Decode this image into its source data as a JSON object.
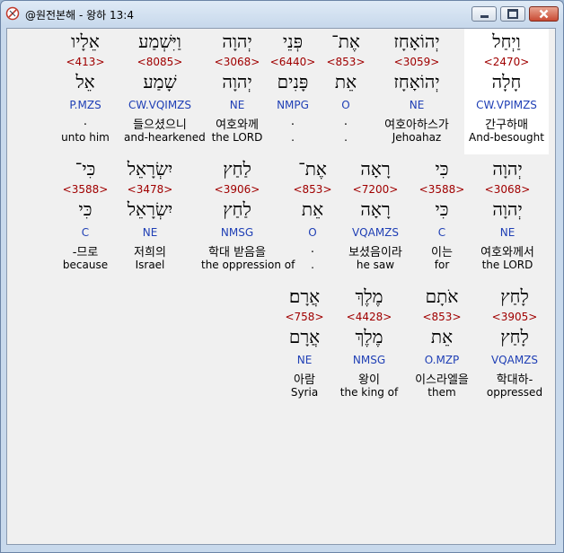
{
  "window": {
    "title": "@원전본해 - 왕하 13:4"
  },
  "verse": {
    "line1": [
      {
        "heb": "וַיְחַל",
        "strong": "<2470>",
        "lemma": "חָלָה",
        "morph": "CW.VPIMZS",
        "kor": "간구하매",
        "eng": "And-besought"
      },
      {
        "heb": "יְהוֹאָחָז",
        "strong": "<3059>",
        "lemma": "יְהוֹאָחָז",
        "morph": "NE",
        "kor": "여호아하스가",
        "eng": "Jehoahaz"
      },
      {
        "heb": "אֶת־",
        "strong": "<853>",
        "lemma": "אֵת",
        "morph": "O",
        "kor": ".",
        "eng": "."
      },
      {
        "heb": "פְּנֵי",
        "strong": "<6440>",
        "lemma": "פָּנִים",
        "morph": "NMPG",
        "kor": ".",
        "eng": "."
      },
      {
        "heb": "יְהוָה",
        "strong": "<3068>",
        "lemma": "יְהוָה",
        "morph": "NE",
        "kor": "여호와께",
        "eng": "the LORD"
      },
      {
        "heb": "וַיִּשְׁמַע",
        "strong": "<8085>",
        "lemma": "שָׁמַע",
        "morph": "CW.VQIMZS",
        "kor": "들으셨으니",
        "eng": "and-hearkened"
      },
      {
        "heb": "אֵלָיו",
        "strong": "<413>",
        "lemma": "אֵל",
        "morph": "P.MZS",
        "kor": ".",
        "eng": "unto him"
      }
    ],
    "line2": [
      {
        "heb": "יְהוָה",
        "strong": "<3068>",
        "lemma": "יְהוָה",
        "morph": "NE",
        "kor": "여호와께서",
        "eng": "the LORD"
      },
      {
        "heb": "כִּי",
        "strong": "<3588>",
        "lemma": "כִּי",
        "morph": "C",
        "kor": "이는",
        "eng": "for"
      },
      {
        "heb": "רָאָה",
        "strong": "<7200>",
        "lemma": "רָאָה",
        "morph": "VQAMZS",
        "kor": "보셨음이라",
        "eng": "he saw"
      },
      {
        "heb": "אֶת־",
        "strong": "<853>",
        "lemma": "אֵת",
        "morph": "O",
        "kor": ".",
        "eng": "."
      },
      {
        "heb": "לַחַץ",
        "strong": "<3906>",
        "lemma": "לַחַץ",
        "morph": "NMSG",
        "kor": "학대 받음을",
        "eng": "the oppression of"
      },
      {
        "heb": "יִשְׂרָאֵל",
        "strong": "<3478>",
        "lemma": "יִשְׂרָאֵל",
        "morph": "NE",
        "kor": "저희의",
        "eng": "Israel"
      },
      {
        "heb": "כִּי־",
        "strong": "<3588>",
        "lemma": "כִּי",
        "morph": "C",
        "kor": "-므로",
        "eng": "because"
      }
    ],
    "line3": [
      {
        "heb": "לָחַץ",
        "strong": "<3905>",
        "lemma": "לָחַץ",
        "morph": "VQAMZS",
        "kor": "학대하-",
        "eng": "oppressed"
      },
      {
        "heb": "אֹתָם",
        "strong": "<853>",
        "lemma": "אֵת",
        "morph": "O.MZP",
        "kor": "이스라엘을",
        "eng": "them"
      },
      {
        "heb": "מֶלֶךְ",
        "strong": "<4428>",
        "lemma": "מֶלֶךְ",
        "morph": "NMSG",
        "kor": "왕이",
        "eng": "the king of"
      },
      {
        "heb": "אֲרָם׃",
        "strong": "<758>",
        "lemma": "אֲרָם",
        "morph": "NE",
        "kor": "아람",
        "eng": "Syria"
      }
    ]
  }
}
